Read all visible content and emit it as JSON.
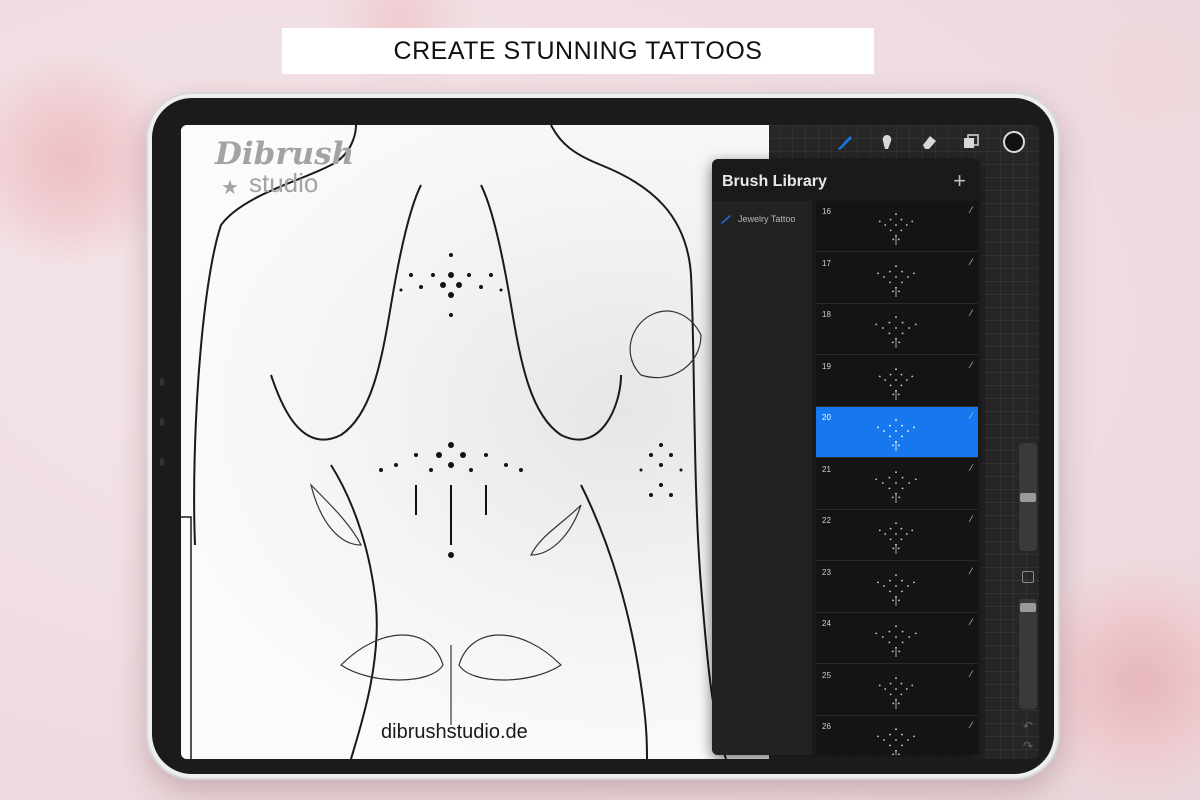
{
  "banner": {
    "text": "CREATE STUNNING TATTOOS"
  },
  "canvas": {
    "logo_top": "Dibrush",
    "logo_bottom": "studio",
    "website": "dibrushstudio.de"
  },
  "toolbar": {
    "tools": [
      {
        "name": "brush-icon",
        "active": true
      },
      {
        "name": "smudge-icon"
      },
      {
        "name": "eraser-icon"
      },
      {
        "name": "layers-icon"
      },
      {
        "name": "color-swatch",
        "color": "#111111"
      }
    ],
    "active_color": "#1677ee"
  },
  "brush_library": {
    "title": "Brush Library",
    "add_icon": "+",
    "set_name": "Jewelry Tattoo",
    "brushes": [
      {
        "number": "16"
      },
      {
        "number": "17"
      },
      {
        "number": "18"
      },
      {
        "number": "19"
      },
      {
        "number": "20",
        "selected": true
      },
      {
        "number": "21"
      },
      {
        "number": "22"
      },
      {
        "number": "23"
      },
      {
        "number": "24"
      },
      {
        "number": "25"
      },
      {
        "number": "26"
      }
    ]
  },
  "side_controls": {
    "undo_icon": "↶",
    "redo_icon": "↷"
  }
}
